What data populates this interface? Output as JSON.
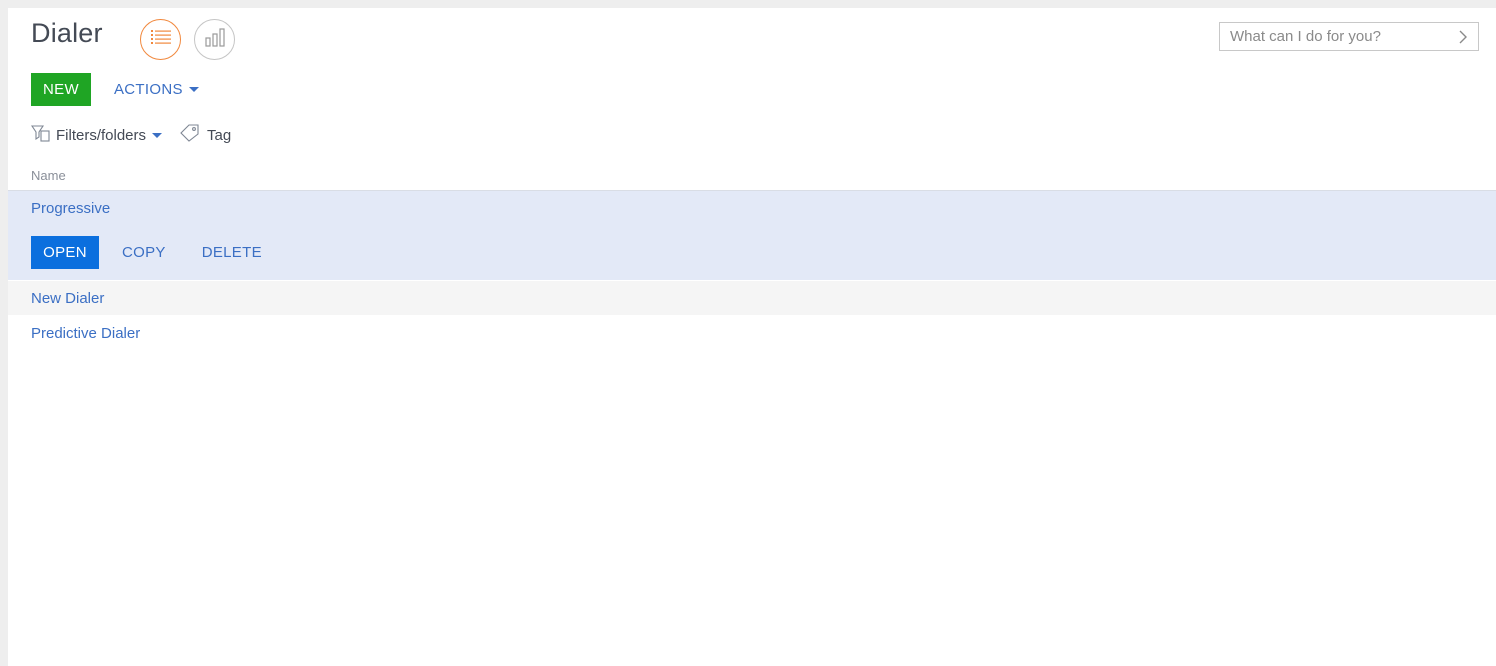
{
  "header": {
    "title": "Dialer",
    "view_list_icon": "list-view-icon",
    "view_chart_icon": "chart-view-icon",
    "accent_color": "#f1883d"
  },
  "search": {
    "placeholder": "What can I do for you?",
    "go_icon": "chevron-right-icon"
  },
  "toolbar": {
    "new_label": "NEW",
    "new_color": "#1fa524",
    "actions_label": "ACTIONS"
  },
  "filters": {
    "filters_label": "Filters/folders",
    "filters_icon": "filter-icon",
    "tag_label": "Tag",
    "tag_icon": "tag-icon"
  },
  "table": {
    "columns": [
      "Name"
    ],
    "rows": [
      {
        "name": "Progressive",
        "selected": true
      },
      {
        "name": "New Dialer",
        "selected": false
      },
      {
        "name": "Predictive Dialer",
        "selected": false
      }
    ],
    "row_actions": {
      "open_label": "OPEN",
      "copy_label": "COPY",
      "delete_label": "DELETE",
      "open_color": "#0b6fde"
    }
  }
}
